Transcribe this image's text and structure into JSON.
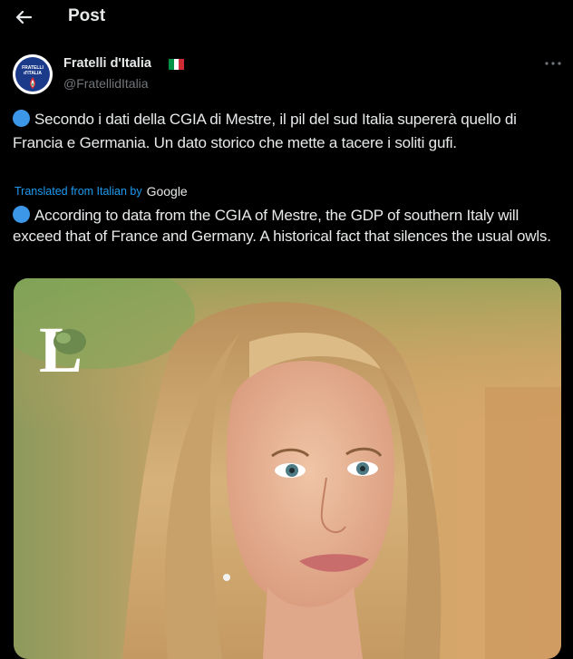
{
  "header": {
    "title": "Post",
    "back_icon": "arrow-left-icon"
  },
  "author": {
    "name": "Fratelli d'Italia",
    "handle": "@FratellidItalia",
    "avatar_text_line1": "FRATELLI",
    "avatar_text_line2": "d'ITALIA",
    "flag_colors": [
      "#009246",
      "#ffffff",
      "#ce2b37"
    ]
  },
  "post": {
    "original_text": "Secondo i dati della CGIA di Mestre, il pil del sud Italia supererà quello di Francia e Germania. Un dato storico che mette a tacere i soliti gufi.",
    "translation_label": "Translated from Italian by",
    "translation_provider": "Google",
    "translated_text": "According to data from the CGIA of Mestre, the GDP of southern Italy will exceed that of France and Germany. A historical fact that silences the usual owls.",
    "bullet_color": "#3d97e8",
    "more_icon": "more-options-icon"
  },
  "media": {
    "watermark_letter": "L"
  },
  "colors": {
    "background": "#000000",
    "text": "#e7e9ea",
    "secondary": "#71767b",
    "link": "#1d9bf0"
  }
}
